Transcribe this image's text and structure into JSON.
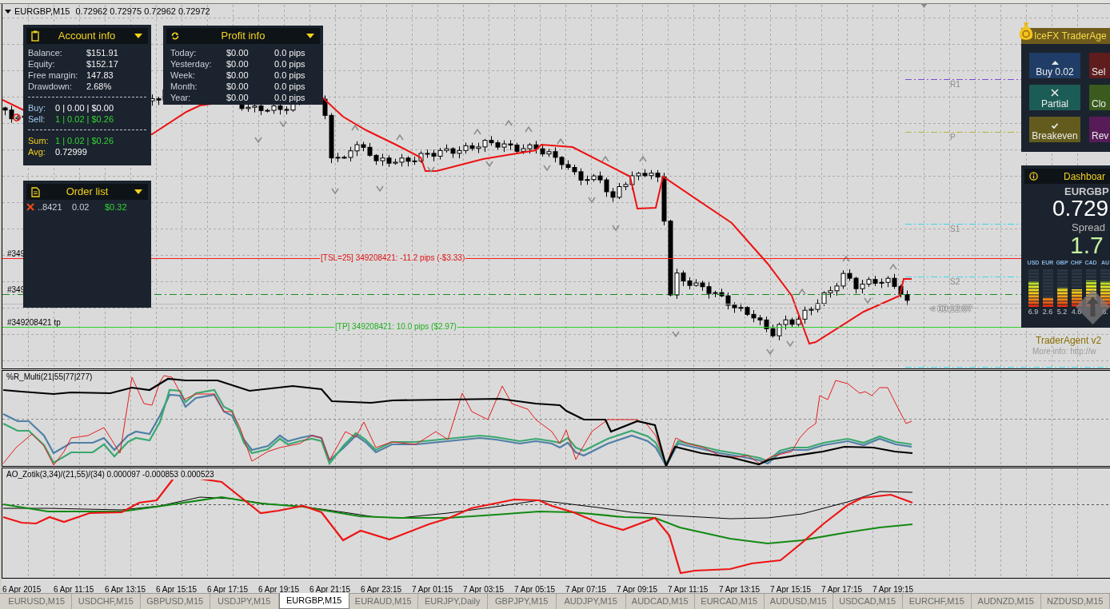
{
  "chart": {
    "symbol": "EURGBP,M15",
    "quotes": "0.72962 0.72975 0.72962 0.72972"
  },
  "account_info": {
    "title": "Account info",
    "rows": [
      {
        "label": "Balance:",
        "value": "$151.91"
      },
      {
        "label": "Equity:",
        "value": "$152.17"
      },
      {
        "label": "Free margin:",
        "value": "147.83"
      },
      {
        "label": "Drawdown:",
        "value": "2.68%"
      }
    ],
    "positions": [
      {
        "kind": "buy",
        "label": "Buy:",
        "value": "0 | 0.00 | $0.00"
      },
      {
        "kind": "sell",
        "label": "Sell:",
        "value": "1 | 0.02 | $0.26"
      }
    ],
    "summary": [
      {
        "kind": "sum",
        "label": "Sum:",
        "value": "1 | 0.02 | $0.26"
      },
      {
        "kind": "avg",
        "label": "Avg:",
        "value": "0.72999"
      }
    ]
  },
  "profit_info": {
    "title": "Profit info",
    "rows": [
      {
        "period": "Today:",
        "amount": "$0.00",
        "pips": "0.0 pips"
      },
      {
        "period": "Yesterday:",
        "amount": "$0.00",
        "pips": "0.0 pips"
      },
      {
        "period": "Week:",
        "amount": "$0.00",
        "pips": "0.0 pips"
      },
      {
        "period": "Month:",
        "amount": "$0.00",
        "pips": "0.0 pips"
      },
      {
        "period": "Year:",
        "amount": "$0.00",
        "pips": "0.0 pips"
      }
    ]
  },
  "order_list": {
    "title": "Order list",
    "orders": [
      {
        "ticket": "..8421",
        "lots": "0.02",
        "profit": "$0.32"
      }
    ]
  },
  "order_lines": [
    {
      "kind": "trailing_stop",
      "tag": "#349",
      "label": "[TSL=25] 349208421: -11.2 pips (-$3.33)"
    },
    {
      "kind": "entry",
      "tag": "#349"
    },
    {
      "kind": "take_profit",
      "tag": "#349208421 tp",
      "label": "[TP] 349208421: 10.0 pips ($2.97)"
    }
  ],
  "pivot_levels": [
    {
      "label": "R1",
      "color": "#7b4fd6"
    },
    {
      "label": "P",
      "color": "#b4b44a"
    },
    {
      "label": "S1",
      "color": "#3fd6e6"
    },
    {
      "label": "S2",
      "color": "#3fd6e6"
    },
    {
      "color": "#3fd6e6"
    }
  ],
  "timer": "< 00:12:07",
  "trader_agent": {
    "title": "IceFX TraderAge",
    "buttons": [
      {
        "kind": "buy",
        "label": "Buy 0.02"
      },
      {
        "kind": "sell",
        "label": "Sel"
      },
      {
        "kind": "partial",
        "label": "Partial"
      },
      {
        "kind": "close",
        "label": "Clo"
      },
      {
        "kind": "breakeven",
        "label": "Breakeven"
      },
      {
        "kind": "reverse",
        "label": "Rev"
      }
    ]
  },
  "dashboard": {
    "title": "Dashboar",
    "symbol": "EURGBP",
    "price": "0.729",
    "spread_label": "Spread",
    "spread": "1.7",
    "currencies": [
      {
        "code": "USD",
        "level": 0.69,
        "value": "6.9"
      },
      {
        "code": "EUR",
        "level": 0.26,
        "value": "2.6"
      },
      {
        "code": "GBP",
        "level": 0.52,
        "value": "5.2"
      },
      {
        "code": "CHF",
        "level": 0.46,
        "value": "4.6"
      },
      {
        "code": "CAD",
        "level": 0.7
      },
      {
        "code": "AU",
        "level": 0.69,
        "value": "6."
      }
    ]
  },
  "footer": {
    "title": "TraderAgent v2",
    "info": "More info: http://w"
  },
  "indicators": [
    {
      "label": "%R_Multi(21|55|77|277)"
    },
    {
      "label": "AO_Zotik(3,34)/(21,55)/(34) 0.000097 -0.000853 0.000523"
    }
  ],
  "time_axis": [
    "6 Apr 2015",
    "6 Apr 11:15",
    "6 Apr 13:15",
    "6 Apr 15:15",
    "6 Apr 17:15",
    "6 Apr 19:15",
    "6 Apr 21:15",
    "6 Apr 23:15",
    "7 Apr 01:15",
    "7 Apr 03:15",
    "7 Apr 05:15",
    "7 Apr 07:15",
    "7 Apr 09:15",
    "7 Apr 11:15",
    "7 Apr 13:15",
    "7 Apr 15:15",
    "7 Apr 17:15",
    "7 Apr 19:15"
  ],
  "tabs": [
    {
      "label": "EURUSD,M15",
      "selected": false
    },
    {
      "label": "USDCHF,M15",
      "selected": false
    },
    {
      "label": "GBPUSD,M15",
      "selected": false
    },
    {
      "label": "USDJPY,M15",
      "selected": false
    },
    {
      "label": "EURGBP,M15",
      "selected": true
    },
    {
      "label": "EURAUD,M15",
      "selected": false
    },
    {
      "label": "EURJPY,Daily",
      "selected": false
    },
    {
      "label": "GBPJPY,M15",
      "selected": false
    },
    {
      "label": "AUDJPY,M15",
      "selected": false
    },
    {
      "label": "AUDCAD,M15",
      "selected": false
    },
    {
      "label": "EURCAD,M15",
      "selected": false
    },
    {
      "label": "AUDUSD,M15",
      "selected": false
    },
    {
      "label": "USDCAD,M15",
      "selected": false
    },
    {
      "label": "EURCHF,M15",
      "selected": false
    },
    {
      "label": "AUDNZD,M15",
      "selected": false
    },
    {
      "label": "NZDUSD,M15",
      "selected": false
    }
  ]
}
